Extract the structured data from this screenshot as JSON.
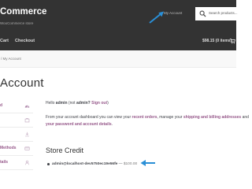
{
  "header": {
    "site_title": "Commerce",
    "tagline": "WooCommerce store",
    "account_link": "My Account",
    "search": {
      "placeholder": "Search products..."
    },
    "nav": [
      {
        "label": "Cart"
      },
      {
        "label": "Checkout"
      }
    ],
    "cart_total": "$98.15 (0 items)"
  },
  "breadcrumb": "/ My Account",
  "page_title": "Account",
  "sidebar": {
    "items": [
      {
        "label": "d",
        "icon": "dashboard-icon"
      },
      {
        "label": "",
        "icon": "orders-icon"
      },
      {
        "label": "",
        "icon": "downloads-icon"
      },
      {
        "label": "Methods",
        "icon": "payment-methods-icon"
      },
      {
        "label": "tails",
        "icon": "account-details-icon"
      }
    ]
  },
  "content": {
    "greeting": {
      "prefix": "Hello",
      "name": "admin",
      "paren_open": "(not",
      "name2": "admin?",
      "logout": "Sign out",
      "paren_close": ")"
    },
    "intro": {
      "line1_a": "From your account dashboard you can view your",
      "recent_orders": "recent orders",
      "line1_b": ", manage your",
      "shipping_billing": "shipping and billing addresses",
      "line1_c": "and",
      "line2_link": "your password and account details",
      "line2_end": "."
    },
    "store_credit": {
      "title": "Store Credit",
      "items": [
        {
          "code": "admin@localhost-dev5750ec19e56fe",
          "separator": " — ",
          "amount": "$100.00"
        }
      ]
    }
  },
  "colors": {
    "header_bg": "#333333",
    "link": "#96588a",
    "annotation_arrow": "#2a8fd6"
  }
}
